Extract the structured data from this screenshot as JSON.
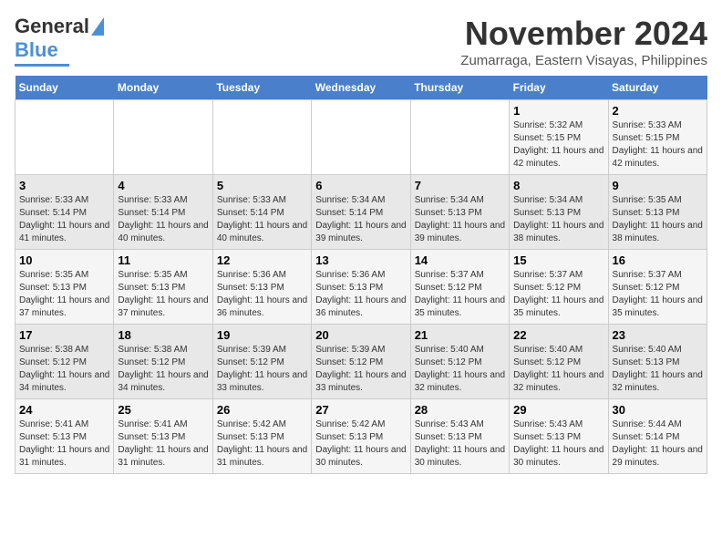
{
  "header": {
    "logo_general": "General",
    "logo_blue": "Blue",
    "month_title": "November 2024",
    "subtitle": "Zumarraga, Eastern Visayas, Philippines"
  },
  "weekdays": [
    "Sunday",
    "Monday",
    "Tuesday",
    "Wednesday",
    "Thursday",
    "Friday",
    "Saturday"
  ],
  "weeks": [
    [
      {
        "day": "",
        "info": ""
      },
      {
        "day": "",
        "info": ""
      },
      {
        "day": "",
        "info": ""
      },
      {
        "day": "",
        "info": ""
      },
      {
        "day": "",
        "info": ""
      },
      {
        "day": "1",
        "info": "Sunrise: 5:32 AM\nSunset: 5:15 PM\nDaylight: 11 hours and 42 minutes."
      },
      {
        "day": "2",
        "info": "Sunrise: 5:33 AM\nSunset: 5:15 PM\nDaylight: 11 hours and 42 minutes."
      }
    ],
    [
      {
        "day": "3",
        "info": "Sunrise: 5:33 AM\nSunset: 5:14 PM\nDaylight: 11 hours and 41 minutes."
      },
      {
        "day": "4",
        "info": "Sunrise: 5:33 AM\nSunset: 5:14 PM\nDaylight: 11 hours and 40 minutes."
      },
      {
        "day": "5",
        "info": "Sunrise: 5:33 AM\nSunset: 5:14 PM\nDaylight: 11 hours and 40 minutes."
      },
      {
        "day": "6",
        "info": "Sunrise: 5:34 AM\nSunset: 5:14 PM\nDaylight: 11 hours and 39 minutes."
      },
      {
        "day": "7",
        "info": "Sunrise: 5:34 AM\nSunset: 5:13 PM\nDaylight: 11 hours and 39 minutes."
      },
      {
        "day": "8",
        "info": "Sunrise: 5:34 AM\nSunset: 5:13 PM\nDaylight: 11 hours and 38 minutes."
      },
      {
        "day": "9",
        "info": "Sunrise: 5:35 AM\nSunset: 5:13 PM\nDaylight: 11 hours and 38 minutes."
      }
    ],
    [
      {
        "day": "10",
        "info": "Sunrise: 5:35 AM\nSunset: 5:13 PM\nDaylight: 11 hours and 37 minutes."
      },
      {
        "day": "11",
        "info": "Sunrise: 5:35 AM\nSunset: 5:13 PM\nDaylight: 11 hours and 37 minutes."
      },
      {
        "day": "12",
        "info": "Sunrise: 5:36 AM\nSunset: 5:13 PM\nDaylight: 11 hours and 36 minutes."
      },
      {
        "day": "13",
        "info": "Sunrise: 5:36 AM\nSunset: 5:13 PM\nDaylight: 11 hours and 36 minutes."
      },
      {
        "day": "14",
        "info": "Sunrise: 5:37 AM\nSunset: 5:12 PM\nDaylight: 11 hours and 35 minutes."
      },
      {
        "day": "15",
        "info": "Sunrise: 5:37 AM\nSunset: 5:12 PM\nDaylight: 11 hours and 35 minutes."
      },
      {
        "day": "16",
        "info": "Sunrise: 5:37 AM\nSunset: 5:12 PM\nDaylight: 11 hours and 35 minutes."
      }
    ],
    [
      {
        "day": "17",
        "info": "Sunrise: 5:38 AM\nSunset: 5:12 PM\nDaylight: 11 hours and 34 minutes."
      },
      {
        "day": "18",
        "info": "Sunrise: 5:38 AM\nSunset: 5:12 PM\nDaylight: 11 hours and 34 minutes."
      },
      {
        "day": "19",
        "info": "Sunrise: 5:39 AM\nSunset: 5:12 PM\nDaylight: 11 hours and 33 minutes."
      },
      {
        "day": "20",
        "info": "Sunrise: 5:39 AM\nSunset: 5:12 PM\nDaylight: 11 hours and 33 minutes."
      },
      {
        "day": "21",
        "info": "Sunrise: 5:40 AM\nSunset: 5:12 PM\nDaylight: 11 hours and 32 minutes."
      },
      {
        "day": "22",
        "info": "Sunrise: 5:40 AM\nSunset: 5:12 PM\nDaylight: 11 hours and 32 minutes."
      },
      {
        "day": "23",
        "info": "Sunrise: 5:40 AM\nSunset: 5:13 PM\nDaylight: 11 hours and 32 minutes."
      }
    ],
    [
      {
        "day": "24",
        "info": "Sunrise: 5:41 AM\nSunset: 5:13 PM\nDaylight: 11 hours and 31 minutes."
      },
      {
        "day": "25",
        "info": "Sunrise: 5:41 AM\nSunset: 5:13 PM\nDaylight: 11 hours and 31 minutes."
      },
      {
        "day": "26",
        "info": "Sunrise: 5:42 AM\nSunset: 5:13 PM\nDaylight: 11 hours and 31 minutes."
      },
      {
        "day": "27",
        "info": "Sunrise: 5:42 AM\nSunset: 5:13 PM\nDaylight: 11 hours and 30 minutes."
      },
      {
        "day": "28",
        "info": "Sunrise: 5:43 AM\nSunset: 5:13 PM\nDaylight: 11 hours and 30 minutes."
      },
      {
        "day": "29",
        "info": "Sunrise: 5:43 AM\nSunset: 5:13 PM\nDaylight: 11 hours and 30 minutes."
      },
      {
        "day": "30",
        "info": "Sunrise: 5:44 AM\nSunset: 5:14 PM\nDaylight: 11 hours and 29 minutes."
      }
    ]
  ]
}
